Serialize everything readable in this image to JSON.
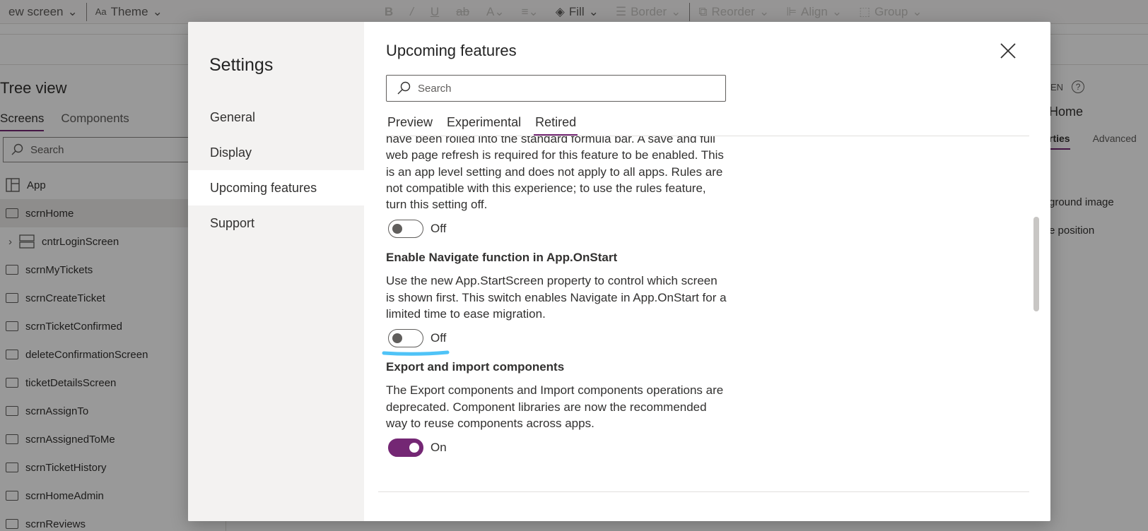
{
  "toolbar": {
    "new_screen": "ew screen",
    "theme": "Theme",
    "fill": "Fill",
    "border": "Border",
    "reorder": "Reorder",
    "align": "Align",
    "group": "Group"
  },
  "tree": {
    "title": "Tree view",
    "tabs": [
      "Screens",
      "Components"
    ],
    "search_placeholder": "Search",
    "items": [
      "App",
      "scrnHome",
      "cntrLoginScreen",
      "scrnMyTickets",
      "scrnCreateTicket",
      "scrnTicketConfirmed",
      "deleteConfirmationScreen",
      "ticketDetailsScreen",
      "scrnAssignTo",
      "scrnAssignedToMe",
      "scrnTicketHistory",
      "scrnHomeAdmin",
      "scrnReviews"
    ]
  },
  "right_panel": {
    "header_fragment": "EN",
    "screen_fragment": "Home",
    "tab_properties_fragment": "rties",
    "tab_advanced": "Advanced",
    "prop1_fragment": "ground image",
    "prop2_fragment": "e position"
  },
  "dialog": {
    "title": "Settings",
    "nav": [
      "General",
      "Display",
      "Upcoming features",
      "Support"
    ],
    "main_title": "Upcoming features",
    "search_placeholder": "Search",
    "tabs": [
      "Preview",
      "Experimental",
      "Retired"
    ],
    "active_tab": "Retired",
    "features": [
      {
        "title": "",
        "description": "have been rolled into the standard formula bar. A save and full web page refresh is required for this feature to be enabled. This is an app level setting and does not apply to all apps. Rules are not compatible with this experience; to use the rules feature, turn this setting off.",
        "toggle_label": "Off",
        "on": false
      },
      {
        "title": "Enable Navigate function in App.OnStart",
        "description": "Use the new App.StartScreen property to control which screen is shown first. This switch enables Navigate in App.OnStart for a limited time to ease migration.",
        "toggle_label": "Off",
        "on": false
      },
      {
        "title": "Export and import components",
        "description": "The Export components and Import components operations are deprecated. Component libraries are now the recommended way to reuse components across apps.",
        "toggle_label": "On",
        "on": true
      }
    ]
  },
  "colors": {
    "accent": "#742774",
    "highlight": "#4fc3f7"
  }
}
